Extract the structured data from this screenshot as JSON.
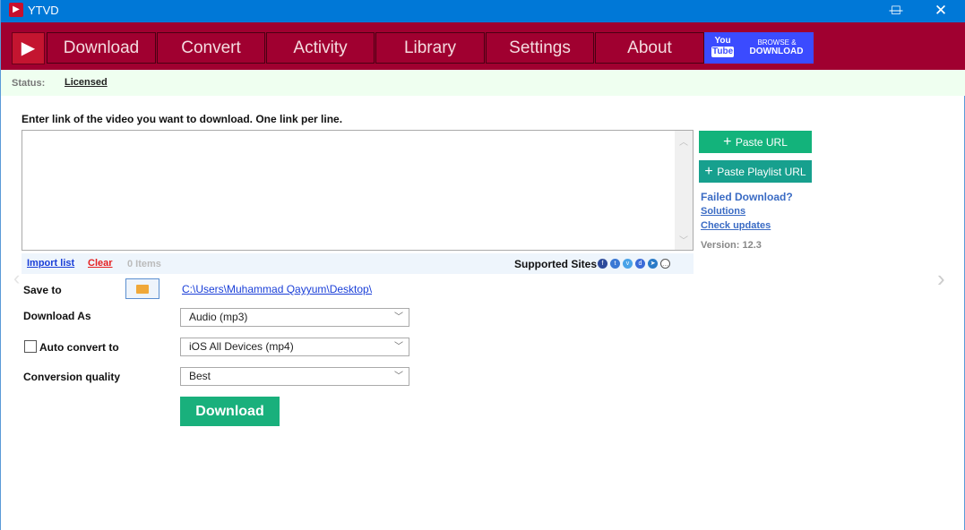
{
  "window": {
    "title": "YTVD"
  },
  "nav": {
    "tabs": [
      "Download",
      "Convert",
      "Activity",
      "Library",
      "Settings",
      "About"
    ],
    "yt_promo": {
      "icon_top": "You",
      "icon_bottom": "Tube",
      "line1": "BROWSE &",
      "line2": "DOWNLOAD"
    }
  },
  "status": {
    "label": "Status:",
    "value": "Licensed"
  },
  "input": {
    "instruction": "Enter link of the video you want to download. One link per line.",
    "value": ""
  },
  "strip": {
    "import": "Import list",
    "clear": "Clear",
    "count": "0 Items",
    "supported": "Supported Sites",
    "sites": [
      "facebook-icon",
      "twitter-icon",
      "vimeo-icon",
      "dailymotion-icon",
      "telegram-icon",
      "more-icon"
    ]
  },
  "side": {
    "paste_url": "Paste URL",
    "paste_playlist": "Paste Playlist URL",
    "failed": "Failed Download?",
    "solutions": "Solutions",
    "check_updates": "Check updates",
    "version": "Version: 12.3"
  },
  "form": {
    "save_to": "Save to",
    "path": "C:\\Users\\Muhammad Qayyum\\Desktop\\",
    "download_as": "Download As",
    "download_as_value": "Audio (mp3)",
    "auto_convert": "Auto convert to",
    "auto_convert_value": "iOS All Devices (mp4)",
    "quality": "Conversion quality",
    "quality_value": "Best",
    "download_button": "Download"
  },
  "colors": {
    "titlebar": "#0078d7",
    "nav": "#a00030",
    "green": "#13b37b",
    "teal": "#17a08e",
    "promo": "#3b4bff"
  }
}
